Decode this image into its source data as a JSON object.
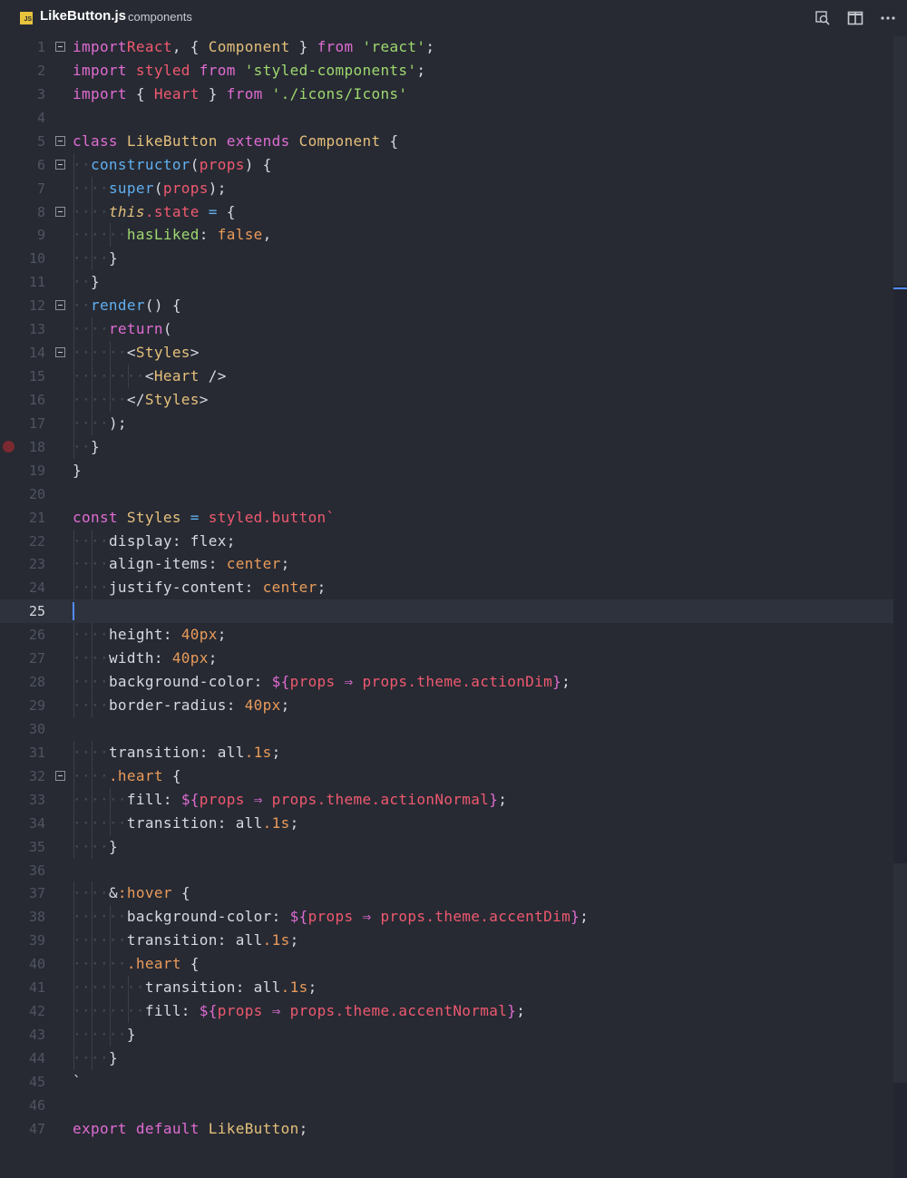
{
  "tab": {
    "icon_label": "JS",
    "filename": "LikeButton.js",
    "path": "components",
    "actions": [
      "open-preview-icon",
      "split-editor-icon",
      "more-icon"
    ],
    "accent": "#e8c33c"
  },
  "editor": {
    "current_line": 25,
    "breakpoint_line": 18,
    "fold_lines": [
      1,
      5,
      6,
      8,
      12,
      14,
      32
    ],
    "lines": [
      {
        "n": "1",
        "indent": 0,
        "tokens": [
          [
            "k",
            "import"
          ],
          [
            "",
            ""
          ],
          [
            "r",
            "React"
          ],
          [
            "",
            ","
          ],
          [
            "",
            "{"
          ],
          [
            "y",
            "Component"
          ],
          [
            "",
            "}"
          ],
          [
            "k",
            "from"
          ],
          [
            "s",
            "'react'"
          ],
          [
            "",
            ";"
          ]
        ]
      },
      {
        "n": "2",
        "indent": 0,
        "tokens": [
          [
            "k",
            "import"
          ],
          [
            "r",
            "styled"
          ],
          [
            "k",
            "from"
          ],
          [
            "s",
            "'styled-components'"
          ],
          [
            "",
            ";"
          ]
        ]
      },
      {
        "n": "3",
        "indent": 0,
        "tokens": [
          [
            "k",
            "import"
          ],
          [
            "",
            "{"
          ],
          [
            "r",
            "Heart"
          ],
          [
            "",
            "}"
          ],
          [
            "k",
            "from"
          ],
          [
            "s",
            "'./icons/Icons'"
          ]
        ]
      },
      {
        "n": "4",
        "indent": 0,
        "tokens": []
      },
      {
        "n": "5",
        "indent": 0,
        "tokens": [
          [
            "k",
            "class"
          ],
          [
            "y",
            "LikeButton"
          ],
          [
            "k",
            "extends"
          ],
          [
            "y",
            "Component"
          ],
          [
            "",
            "{"
          ]
        ]
      },
      {
        "n": "6",
        "indent": 1,
        "tokens": [
          [
            "f",
            "constructor"
          ],
          [
            "",
            "("
          ],
          [
            "r",
            "props"
          ],
          [
            "",
            ")"
          ],
          [
            "",
            "{"
          ]
        ]
      },
      {
        "n": "7",
        "indent": 2,
        "tokens": [
          [
            "f",
            "super"
          ],
          [
            "",
            "("
          ],
          [
            "r",
            "props"
          ],
          [
            "",
            ");"
          ]
        ]
      },
      {
        "n": "8",
        "indent": 2,
        "tokens": [
          [
            "it",
            "this"
          ],
          [
            "r",
            ".state"
          ],
          [
            "f",
            "="
          ],
          [
            "",
            "{"
          ]
        ]
      },
      {
        "n": "9",
        "indent": 3,
        "tokens": [
          [
            "s",
            "hasLiked"
          ],
          [
            "",
            ":"
          ],
          [
            "o",
            "false"
          ],
          [
            "",
            ","
          ]
        ]
      },
      {
        "n": "10",
        "indent": 2,
        "tokens": [
          [
            "",
            "}"
          ]
        ]
      },
      {
        "n": "11",
        "indent": 1,
        "tokens": [
          [
            "",
            "}"
          ]
        ]
      },
      {
        "n": "12",
        "indent": 1,
        "tokens": [
          [
            "f",
            "render"
          ],
          [
            "",
            "()"
          ],
          [
            "",
            "{"
          ]
        ]
      },
      {
        "n": "13",
        "indent": 2,
        "tokens": [
          [
            "k",
            "return"
          ],
          [
            "",
            "("
          ]
        ]
      },
      {
        "n": "14",
        "indent": 3,
        "tokens": [
          [
            "",
            "<"
          ],
          [
            "y",
            "Styles"
          ],
          [
            "",
            ">"
          ]
        ]
      },
      {
        "n": "15",
        "indent": 4,
        "tokens": [
          [
            "",
            "<"
          ],
          [
            "y",
            "Heart"
          ],
          [
            "",
            "/>"
          ]
        ]
      },
      {
        "n": "16",
        "indent": 3,
        "tokens": [
          [
            "",
            "</"
          ],
          [
            "y",
            "Styles"
          ],
          [
            "",
            ">"
          ]
        ]
      },
      {
        "n": "17",
        "indent": 2,
        "tokens": [
          [
            "",
            ");"
          ]
        ]
      },
      {
        "n": "18",
        "indent": 1,
        "tokens": [
          [
            "",
            "}"
          ]
        ]
      },
      {
        "n": "19",
        "indent": 0,
        "tokens": [
          [
            "",
            "}"
          ]
        ]
      },
      {
        "n": "20",
        "indent": 0,
        "tokens": []
      },
      {
        "n": "21",
        "indent": 0,
        "tokens": [
          [
            "k",
            "const"
          ],
          [
            "y",
            "Styles"
          ],
          [
            "f",
            "="
          ],
          [
            "r",
            "styled.button`"
          ]
        ]
      },
      {
        "n": "22",
        "indent": 2,
        "tokens": [
          [
            "",
            "display:"
          ],
          [
            "",
            "flex;"
          ]
        ]
      },
      {
        "n": "23",
        "indent": 2,
        "tokens": [
          [
            "",
            "align-items:"
          ],
          [
            "o",
            "center"
          ],
          [
            "",
            ";"
          ]
        ]
      },
      {
        "n": "24",
        "indent": 2,
        "tokens": [
          [
            "",
            "justify-content:"
          ],
          [
            "o",
            "center"
          ],
          [
            "",
            ";"
          ]
        ]
      },
      {
        "n": "25",
        "indent": 0,
        "tokens": []
      },
      {
        "n": "26",
        "indent": 2,
        "tokens": [
          [
            "",
            "height:"
          ],
          [
            "o",
            "40px"
          ],
          [
            "",
            ";"
          ]
        ]
      },
      {
        "n": "27",
        "indent": 2,
        "tokens": [
          [
            "",
            "width:"
          ],
          [
            "o",
            "40px"
          ],
          [
            "",
            ";"
          ]
        ]
      },
      {
        "n": "28",
        "indent": 2,
        "tokens": [
          [
            "",
            "background-color:"
          ],
          [
            "k",
            "${"
          ],
          [
            "r",
            "props"
          ],
          [
            "k",
            "⇒"
          ],
          [
            "r",
            "props.theme.actionDim"
          ],
          [
            "k",
            "}"
          ],
          [
            "",
            ";"
          ]
        ]
      },
      {
        "n": "29",
        "indent": 2,
        "tokens": [
          [
            "",
            "border-radius:"
          ],
          [
            "o",
            "40px"
          ],
          [
            "",
            ";"
          ]
        ]
      },
      {
        "n": "30",
        "indent": 0,
        "tokens": []
      },
      {
        "n": "31",
        "indent": 2,
        "tokens": [
          [
            "",
            "transition:"
          ],
          [
            "",
            "all"
          ],
          [
            "o",
            ".1s"
          ],
          [
            "",
            ";"
          ]
        ]
      },
      {
        "n": "32",
        "indent": 2,
        "tokens": [
          [
            "o",
            ".heart"
          ],
          [
            "",
            "{"
          ]
        ]
      },
      {
        "n": "33",
        "indent": 3,
        "tokens": [
          [
            "",
            "fill:"
          ],
          [
            "k",
            "${"
          ],
          [
            "r",
            "props"
          ],
          [
            "k",
            "⇒"
          ],
          [
            "r",
            "props.theme.actionNormal"
          ],
          [
            "k",
            "}"
          ],
          [
            "",
            ";"
          ]
        ]
      },
      {
        "n": "34",
        "indent": 3,
        "tokens": [
          [
            "",
            "transition:"
          ],
          [
            "",
            "all"
          ],
          [
            "o",
            ".1s"
          ],
          [
            "",
            ";"
          ]
        ]
      },
      {
        "n": "35",
        "indent": 2,
        "tokens": [
          [
            "",
            "}"
          ]
        ]
      },
      {
        "n": "36",
        "indent": 0,
        "tokens": []
      },
      {
        "n": "37",
        "indent": 2,
        "tokens": [
          [
            "",
            "&"
          ],
          [
            "o",
            ":hover"
          ],
          [
            "",
            "{"
          ]
        ]
      },
      {
        "n": "38",
        "indent": 3,
        "tokens": [
          [
            "",
            "background-color:"
          ],
          [
            "k",
            "${"
          ],
          [
            "r",
            "props"
          ],
          [
            "k",
            "⇒"
          ],
          [
            "r",
            "props.theme.accentDim"
          ],
          [
            "k",
            "}"
          ],
          [
            "",
            ";"
          ]
        ]
      },
      {
        "n": "39",
        "indent": 3,
        "tokens": [
          [
            "",
            "transition:"
          ],
          [
            "",
            "all"
          ],
          [
            "o",
            ".1s"
          ],
          [
            "",
            ";"
          ]
        ]
      },
      {
        "n": "40",
        "indent": 3,
        "tokens": [
          [
            "o",
            ".heart"
          ],
          [
            "",
            "{"
          ]
        ]
      },
      {
        "n": "41",
        "indent": 4,
        "tokens": [
          [
            "",
            "transition:"
          ],
          [
            "",
            "all"
          ],
          [
            "o",
            ".1s"
          ],
          [
            "",
            ";"
          ]
        ]
      },
      {
        "n": "42",
        "indent": 4,
        "tokens": [
          [
            "",
            "fill:"
          ],
          [
            "k",
            "${"
          ],
          [
            "r",
            "props"
          ],
          [
            "k",
            "⇒"
          ],
          [
            "r",
            "props.theme.accentNormal"
          ],
          [
            "k",
            "}"
          ],
          [
            "",
            ";"
          ]
        ]
      },
      {
        "n": "43",
        "indent": 3,
        "tokens": [
          [
            "",
            "}"
          ]
        ]
      },
      {
        "n": "44",
        "indent": 2,
        "tokens": [
          [
            "",
            "}"
          ]
        ]
      },
      {
        "n": "45",
        "indent": 0,
        "tokens": [
          [
            "",
            "`"
          ]
        ]
      },
      {
        "n": "46",
        "indent": 0,
        "tokens": []
      },
      {
        "n": "47",
        "indent": 0,
        "tokens": [
          [
            "k",
            "export"
          ],
          [
            "k",
            "default"
          ],
          [
            "y",
            "LikeButton"
          ],
          [
            "",
            ";"
          ]
        ]
      }
    ]
  }
}
